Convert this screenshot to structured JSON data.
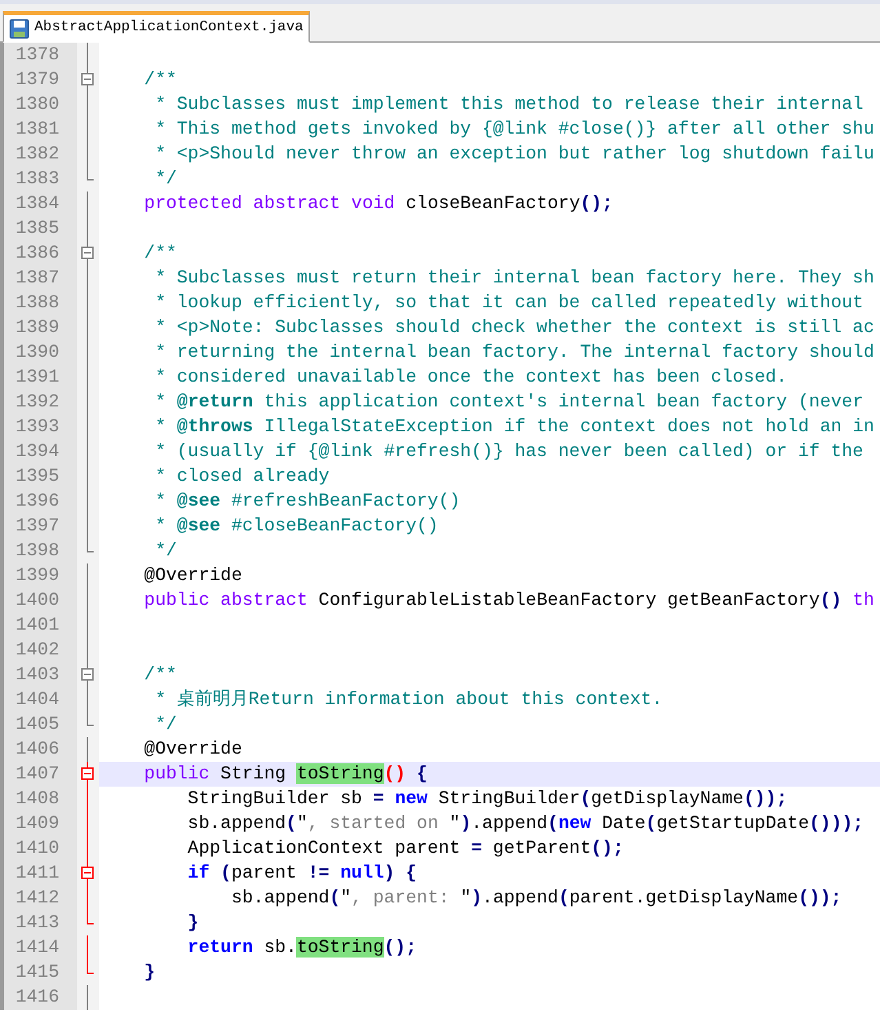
{
  "tabs": [
    {
      "label": "AbstractApplicationContext.java",
      "selected": true
    }
  ],
  "lines": [
    {
      "number": "1378",
      "kind": "body",
      "active": false,
      "current": false
    },
    {
      "number": "1379",
      "kind": "fold",
      "active": false,
      "current": false,
      "tokens": [
        {
          "kind": "comment",
          "text": "    /**"
        }
      ]
    },
    {
      "number": "1380",
      "kind": "body",
      "active": false,
      "current": false,
      "tokens": [
        {
          "kind": "comment",
          "text": "     * Subclasses must implement this method to release their internal"
        }
      ]
    },
    {
      "number": "1381",
      "kind": "body",
      "active": false,
      "current": false,
      "tokens": [
        {
          "kind": "comment",
          "text": "     * This method gets invoked by {@link #close()} after all other shu"
        }
      ]
    },
    {
      "number": "1382",
      "kind": "body",
      "active": false,
      "current": false,
      "tokens": [
        {
          "kind": "comment",
          "text": "     * <p>Should never throw an exception but rather log shutdown failu"
        }
      ]
    },
    {
      "number": "1383",
      "kind": "end",
      "active": false,
      "current": false,
      "tokens": [
        {
          "kind": "comment",
          "text": "     */"
        }
      ]
    },
    {
      "number": "1384",
      "kind": "body",
      "active": false,
      "current": false,
      "tokens": [
        {
          "kind": "keyword",
          "text": "    protected"
        },
        {
          "kind": "keyword",
          "text": " abstract"
        },
        {
          "kind": "keyword",
          "text": " void"
        },
        {
          "kind": "plain",
          "text": " closeBeanFactory"
        },
        {
          "kind": "operator",
          "text": "();"
        }
      ]
    },
    {
      "number": "1385",
      "kind": "body",
      "active": false,
      "current": false
    },
    {
      "number": "1386",
      "kind": "fold",
      "active": false,
      "current": false,
      "tokens": [
        {
          "kind": "comment",
          "text": "    /**"
        }
      ]
    },
    {
      "number": "1387",
      "kind": "body",
      "active": false,
      "current": false,
      "tokens": [
        {
          "kind": "comment",
          "text": "     * Subclasses must return their internal bean factory here. They sh"
        }
      ]
    },
    {
      "number": "1388",
      "kind": "body",
      "active": false,
      "current": false,
      "tokens": [
        {
          "kind": "comment",
          "text": "     * lookup efficiently, so that it can be called repeatedly without"
        }
      ]
    },
    {
      "number": "1389",
      "kind": "body",
      "active": false,
      "current": false,
      "tokens": [
        {
          "kind": "comment",
          "text": "     * <p>Note: Subclasses should check whether the context is still ac"
        }
      ]
    },
    {
      "number": "1390",
      "kind": "body",
      "active": false,
      "current": false,
      "tokens": [
        {
          "kind": "comment",
          "text": "     * returning the internal bean factory. The internal factory should"
        }
      ]
    },
    {
      "number": "1391",
      "kind": "body",
      "active": false,
      "current": false,
      "tokens": [
        {
          "kind": "comment",
          "text": "     * considered unavailable once the context has been closed."
        }
      ]
    },
    {
      "number": "1392",
      "kind": "body",
      "active": false,
      "current": false,
      "tokens": [
        {
          "kind": "comment",
          "text": "     * "
        },
        {
          "kind": "doctag",
          "text": "@return"
        },
        {
          "kind": "comment",
          "text": " this application context's internal bean factory (never"
        }
      ]
    },
    {
      "number": "1393",
      "kind": "body",
      "active": false,
      "current": false,
      "tokens": [
        {
          "kind": "comment",
          "text": "     * "
        },
        {
          "kind": "doctag",
          "text": "@throws"
        },
        {
          "kind": "comment",
          "text": " IllegalStateException if the context does not hold an in"
        }
      ]
    },
    {
      "number": "1394",
      "kind": "body",
      "active": false,
      "current": false,
      "tokens": [
        {
          "kind": "comment",
          "text": "     * (usually if {@link #refresh()} has never been called) or if the"
        }
      ]
    },
    {
      "number": "1395",
      "kind": "body",
      "active": false,
      "current": false,
      "tokens": [
        {
          "kind": "comment",
          "text": "     * closed already"
        }
      ]
    },
    {
      "number": "1396",
      "kind": "body",
      "active": false,
      "current": false,
      "tokens": [
        {
          "kind": "comment",
          "text": "     * "
        },
        {
          "kind": "doctag",
          "text": "@see"
        },
        {
          "kind": "comment",
          "text": " #refreshBeanFactory()"
        }
      ]
    },
    {
      "number": "1397",
      "kind": "body",
      "active": false,
      "current": false,
      "tokens": [
        {
          "kind": "comment",
          "text": "     * "
        },
        {
          "kind": "doctag",
          "text": "@see"
        },
        {
          "kind": "comment",
          "text": " #closeBeanFactory()"
        }
      ]
    },
    {
      "number": "1398",
      "kind": "end",
      "active": false,
      "current": false,
      "tokens": [
        {
          "kind": "comment",
          "text": "     */"
        }
      ]
    },
    {
      "number": "1399",
      "kind": "body",
      "active": false,
      "current": false,
      "tokens": [
        {
          "kind": "plain",
          "text": "    @Override"
        }
      ]
    },
    {
      "number": "1400",
      "kind": "body",
      "active": false,
      "current": false,
      "tokens": [
        {
          "kind": "keyword",
          "text": "    public"
        },
        {
          "kind": "keyword",
          "text": " abstract"
        },
        {
          "kind": "plain",
          "text": " ConfigurableListableBeanFactory getBeanFactory"
        },
        {
          "kind": "operator",
          "text": "()"
        },
        {
          "kind": "keyword",
          "text": " th"
        }
      ]
    },
    {
      "number": "1401",
      "kind": "body",
      "active": false,
      "current": false
    },
    {
      "number": "1402",
      "kind": "body",
      "active": false,
      "current": false
    },
    {
      "number": "1403",
      "kind": "fold",
      "active": false,
      "current": false,
      "tokens": [
        {
          "kind": "comment",
          "text": "    /**"
        }
      ]
    },
    {
      "number": "1404",
      "kind": "body",
      "active": false,
      "current": false,
      "tokens": [
        {
          "kind": "comment",
          "text": "     * 桌前明月Return information about this context."
        }
      ]
    },
    {
      "number": "1405",
      "kind": "end",
      "active": false,
      "current": false,
      "tokens": [
        {
          "kind": "comment",
          "text": "     */"
        }
      ]
    },
    {
      "number": "1406",
      "kind": "body",
      "active": false,
      "current": false,
      "tokens": [
        {
          "kind": "plain",
          "text": "    @Override"
        }
      ]
    },
    {
      "number": "1407",
      "kind": "fold",
      "active": true,
      "current": true,
      "tokens": [
        {
          "kind": "keyword",
          "text": "    public"
        },
        {
          "kind": "plain",
          "text": " String "
        },
        {
          "kind": "highlight",
          "text": "toString"
        },
        {
          "kind": "brace_match",
          "text": "()"
        },
        {
          "kind": "operator",
          "text": " {"
        }
      ]
    },
    {
      "number": "1408",
      "kind": "body",
      "active": true,
      "current": false,
      "tokens": [
        {
          "kind": "plain",
          "text": "        StringBuilder sb "
        },
        {
          "kind": "operator",
          "text": "="
        },
        {
          "kind": "keyword2",
          "text": " new"
        },
        {
          "kind": "plain",
          "text": " StringBuilder"
        },
        {
          "kind": "operator",
          "text": "("
        },
        {
          "kind": "plain",
          "text": "getDisplayName"
        },
        {
          "kind": "operator",
          "text": "());"
        }
      ]
    },
    {
      "number": "1409",
      "kind": "body",
      "active": true,
      "current": false,
      "tokens": [
        {
          "kind": "plain",
          "text": "        sb.append"
        },
        {
          "kind": "operator",
          "text": "("
        },
        {
          "kind": "plain",
          "text": "\""
        },
        {
          "kind": "string",
          "text": ", started on "
        },
        {
          "kind": "plain",
          "text": "\""
        },
        {
          "kind": "operator",
          "text": ")"
        },
        {
          "kind": "plain",
          "text": ".append"
        },
        {
          "kind": "operator",
          "text": "("
        },
        {
          "kind": "keyword2",
          "text": "new"
        },
        {
          "kind": "plain",
          "text": " Date"
        },
        {
          "kind": "operator",
          "text": "("
        },
        {
          "kind": "plain",
          "text": "getStartupDate"
        },
        {
          "kind": "operator",
          "text": "()));"
        }
      ]
    },
    {
      "number": "1410",
      "kind": "body",
      "active": true,
      "current": false,
      "tokens": [
        {
          "kind": "plain",
          "text": "        ApplicationContext parent "
        },
        {
          "kind": "operator",
          "text": "="
        },
        {
          "kind": "plain",
          "text": " getParent"
        },
        {
          "kind": "operator",
          "text": "();"
        }
      ]
    },
    {
      "number": "1411",
      "kind": "fold",
      "active": true,
      "current": false,
      "tokens": [
        {
          "kind": "keyword2",
          "text": "        if"
        },
        {
          "kind": "operator",
          "text": " ("
        },
        {
          "kind": "plain",
          "text": "parent "
        },
        {
          "kind": "operator",
          "text": "!="
        },
        {
          "kind": "keyword2",
          "text": " null"
        },
        {
          "kind": "operator",
          "text": ") {"
        }
      ]
    },
    {
      "number": "1412",
      "kind": "body",
      "active": true,
      "current": false,
      "tokens": [
        {
          "kind": "plain",
          "text": "            sb.append"
        },
        {
          "kind": "operator",
          "text": "("
        },
        {
          "kind": "plain",
          "text": "\""
        },
        {
          "kind": "string",
          "text": ", parent: "
        },
        {
          "kind": "plain",
          "text": "\""
        },
        {
          "kind": "operator",
          "text": ")"
        },
        {
          "kind": "plain",
          "text": ".append"
        },
        {
          "kind": "operator",
          "text": "("
        },
        {
          "kind": "plain",
          "text": "parent.getDisplayName"
        },
        {
          "kind": "operator",
          "text": "());"
        }
      ]
    },
    {
      "number": "1413",
      "kind": "end",
      "active": true,
      "current": false,
      "tokens": [
        {
          "kind": "operator",
          "text": "        }"
        }
      ]
    },
    {
      "number": "1414",
      "kind": "body",
      "active": true,
      "current": false,
      "tokens": [
        {
          "kind": "keyword2",
          "text": "        return"
        },
        {
          "kind": "plain",
          "text": " sb."
        },
        {
          "kind": "highlight",
          "text": "toString"
        },
        {
          "kind": "operator",
          "text": "();"
        }
      ]
    },
    {
      "number": "1415",
      "kind": "end",
      "active": true,
      "current": false,
      "tokens": [
        {
          "kind": "operator",
          "text": "    }"
        }
      ]
    },
    {
      "number": "1416",
      "kind": "body",
      "active": false,
      "current": false
    }
  ]
}
